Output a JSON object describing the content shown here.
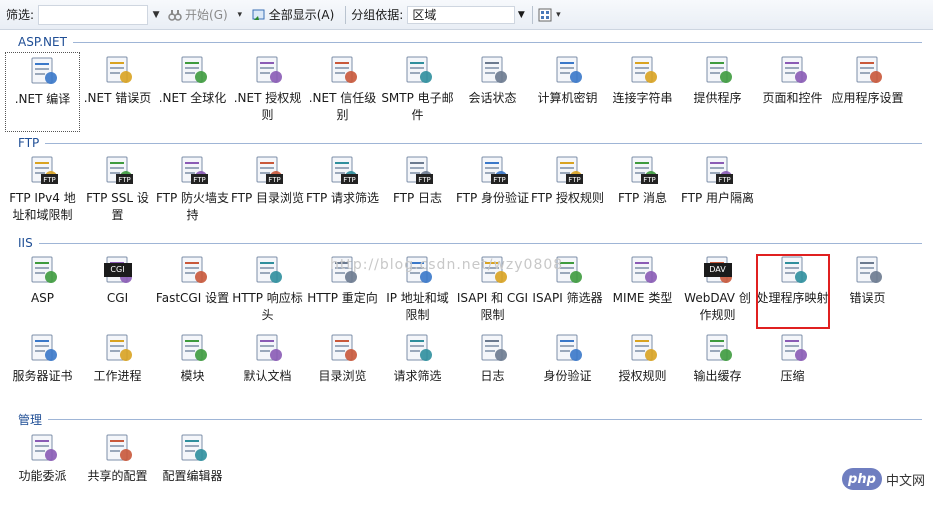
{
  "toolbar": {
    "filter_label": "筛选:",
    "start_label": "开始(G)",
    "show_all_label": "全部显示(A)",
    "group_by_label": "分组依据:",
    "group_by_value": "区域"
  },
  "groups": [
    {
      "title": "ASP.NET",
      "items": [
        {
          "label": ".NET 编译",
          "icon": "dotnet-compile-icon"
        },
        {
          "label": ".NET 错误页",
          "icon": "dotnet-error-page-icon"
        },
        {
          "label": ".NET 全球化",
          "icon": "globe-icon"
        },
        {
          "label": ".NET 授权规则",
          "icon": "authorization-rules-icon"
        },
        {
          "label": ".NET 信任级别",
          "icon": "trust-level-icon"
        },
        {
          "label": "SMTP 电子邮件",
          "icon": "smtp-email-icon"
        },
        {
          "label": "会话状态",
          "icon": "session-state-icon"
        },
        {
          "label": "计算机密钥",
          "icon": "machine-key-icon"
        },
        {
          "label": "连接字符串",
          "icon": "connection-string-icon"
        },
        {
          "label": "提供程序",
          "icon": "providers-icon"
        },
        {
          "label": "页面和控件",
          "icon": "pages-controls-icon"
        },
        {
          "label": "应用程序设置",
          "icon": "app-settings-icon"
        }
      ]
    },
    {
      "title": "FTP",
      "items": [
        {
          "label": "FTP IPv4 地址和域限制",
          "icon": "ftp-ip-restrictions-icon"
        },
        {
          "label": "FTP SSL 设置",
          "icon": "ftp-ssl-icon"
        },
        {
          "label": "FTP 防火墙支持",
          "icon": "ftp-firewall-icon"
        },
        {
          "label": "FTP 目录浏览",
          "icon": "ftp-directory-browsing-icon"
        },
        {
          "label": "FTP 请求筛选",
          "icon": "ftp-request-filtering-icon"
        },
        {
          "label": "FTP 日志",
          "icon": "ftp-logging-icon"
        },
        {
          "label": "FTP 身份验证",
          "icon": "ftp-authentication-icon"
        },
        {
          "label": "FTP 授权规则",
          "icon": "ftp-authorization-icon"
        },
        {
          "label": "FTP 消息",
          "icon": "ftp-messages-icon"
        },
        {
          "label": "FTP 用户隔离",
          "icon": "ftp-user-isolation-icon"
        }
      ]
    },
    {
      "title": "IIS",
      "items": [
        {
          "label": "ASP",
          "icon": "asp-icon"
        },
        {
          "label": "CGI",
          "icon": "cgi-icon",
          "badge": "CGI"
        },
        {
          "label": "FastCGI 设置",
          "icon": "fastcgi-icon"
        },
        {
          "label": "HTTP 响应标头",
          "icon": "http-response-headers-icon"
        },
        {
          "label": "HTTP 重定向",
          "icon": "http-redirect-icon"
        },
        {
          "label": "IP 地址和域限制",
          "icon": "ip-restrictions-icon"
        },
        {
          "label": "ISAPI 和 CGI 限制",
          "icon": "isapi-cgi-restrictions-icon"
        },
        {
          "label": "ISAPI 筛选器",
          "icon": "isapi-filters-icon"
        },
        {
          "label": "MIME 类型",
          "icon": "mime-types-icon"
        },
        {
          "label": "WebDAV 创作规则",
          "icon": "webdav-icon",
          "badge": "DAV"
        },
        {
          "label": "处理程序映射",
          "icon": "handler-mappings-icon"
        },
        {
          "label": "错误页",
          "icon": "error-pages-icon"
        },
        {
          "label": "服务器证书",
          "icon": "server-certificates-icon"
        },
        {
          "label": "工作进程",
          "icon": "worker-processes-icon"
        },
        {
          "label": "模块",
          "icon": "modules-icon"
        },
        {
          "label": "默认文档",
          "icon": "default-document-icon"
        },
        {
          "label": "目录浏览",
          "icon": "directory-browsing-icon"
        },
        {
          "label": "请求筛选",
          "icon": "request-filtering-icon"
        },
        {
          "label": "日志",
          "icon": "logging-icon"
        },
        {
          "label": "身份验证",
          "icon": "authentication-icon"
        },
        {
          "label": "授权规则",
          "icon": "authorization-icon"
        },
        {
          "label": "输出缓存",
          "icon": "output-caching-icon"
        },
        {
          "label": "压缩",
          "icon": "compression-icon"
        }
      ]
    },
    {
      "title": "管理",
      "items": [
        {
          "label": "功能委派",
          "icon": "feature-delegation-icon"
        },
        {
          "label": "共享的配置",
          "icon": "shared-configuration-icon"
        },
        {
          "label": "配置编辑器",
          "icon": "configuration-editor-icon"
        }
      ]
    }
  ],
  "watermark": "http://blog.csdn.net/wzy0808",
  "logo": {
    "badge": "php",
    "site": "中文网"
  },
  "colors": {
    "group_header": "#1f4e95",
    "highlight": "#e02020",
    "ftp_badge": "#222222"
  }
}
